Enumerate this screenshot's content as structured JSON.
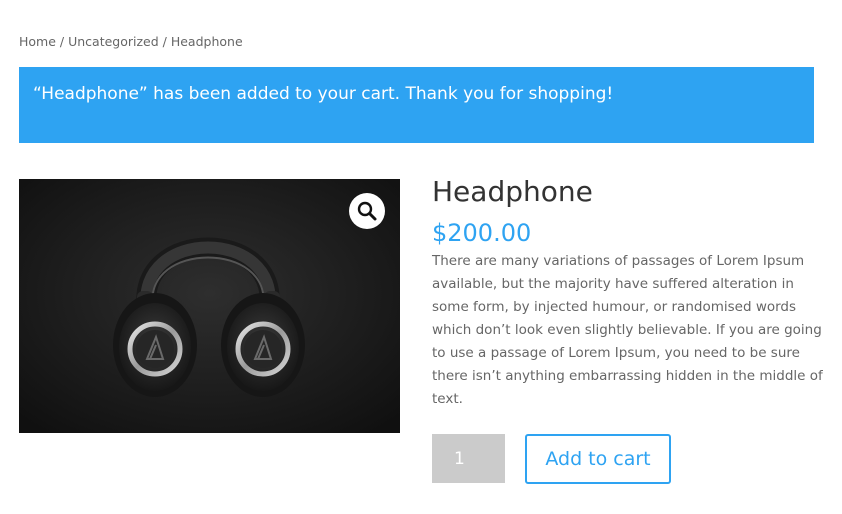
{
  "breadcrumb": {
    "home": "Home",
    "separator": " / ",
    "category": "Uncategorized",
    "current": "Headphone"
  },
  "notice": {
    "message": "“Headphone” has been added to your cart. Thank you for shopping!",
    "color": "#2ea3f2"
  },
  "product": {
    "title": "Headphone",
    "price": "$200.00",
    "description_lines": [
      "There are many variations of passages of Lorem Ipsum",
      "available, but the majority have suffered alteration in",
      "some form, by injected humour, or randomised words",
      "which don’t look even slightly believable. If you are going",
      "to use a passage of Lorem Ipsum, you need to be sure",
      "there isn’t anything embarrassing hidden in the middle of",
      "text."
    ],
    "image_icon": "headphones-product-image",
    "zoom_icon": "magnifier-icon"
  },
  "cart": {
    "quantity": "1",
    "add_label": "Add to cart",
    "accent": "#2ea3f2"
  }
}
